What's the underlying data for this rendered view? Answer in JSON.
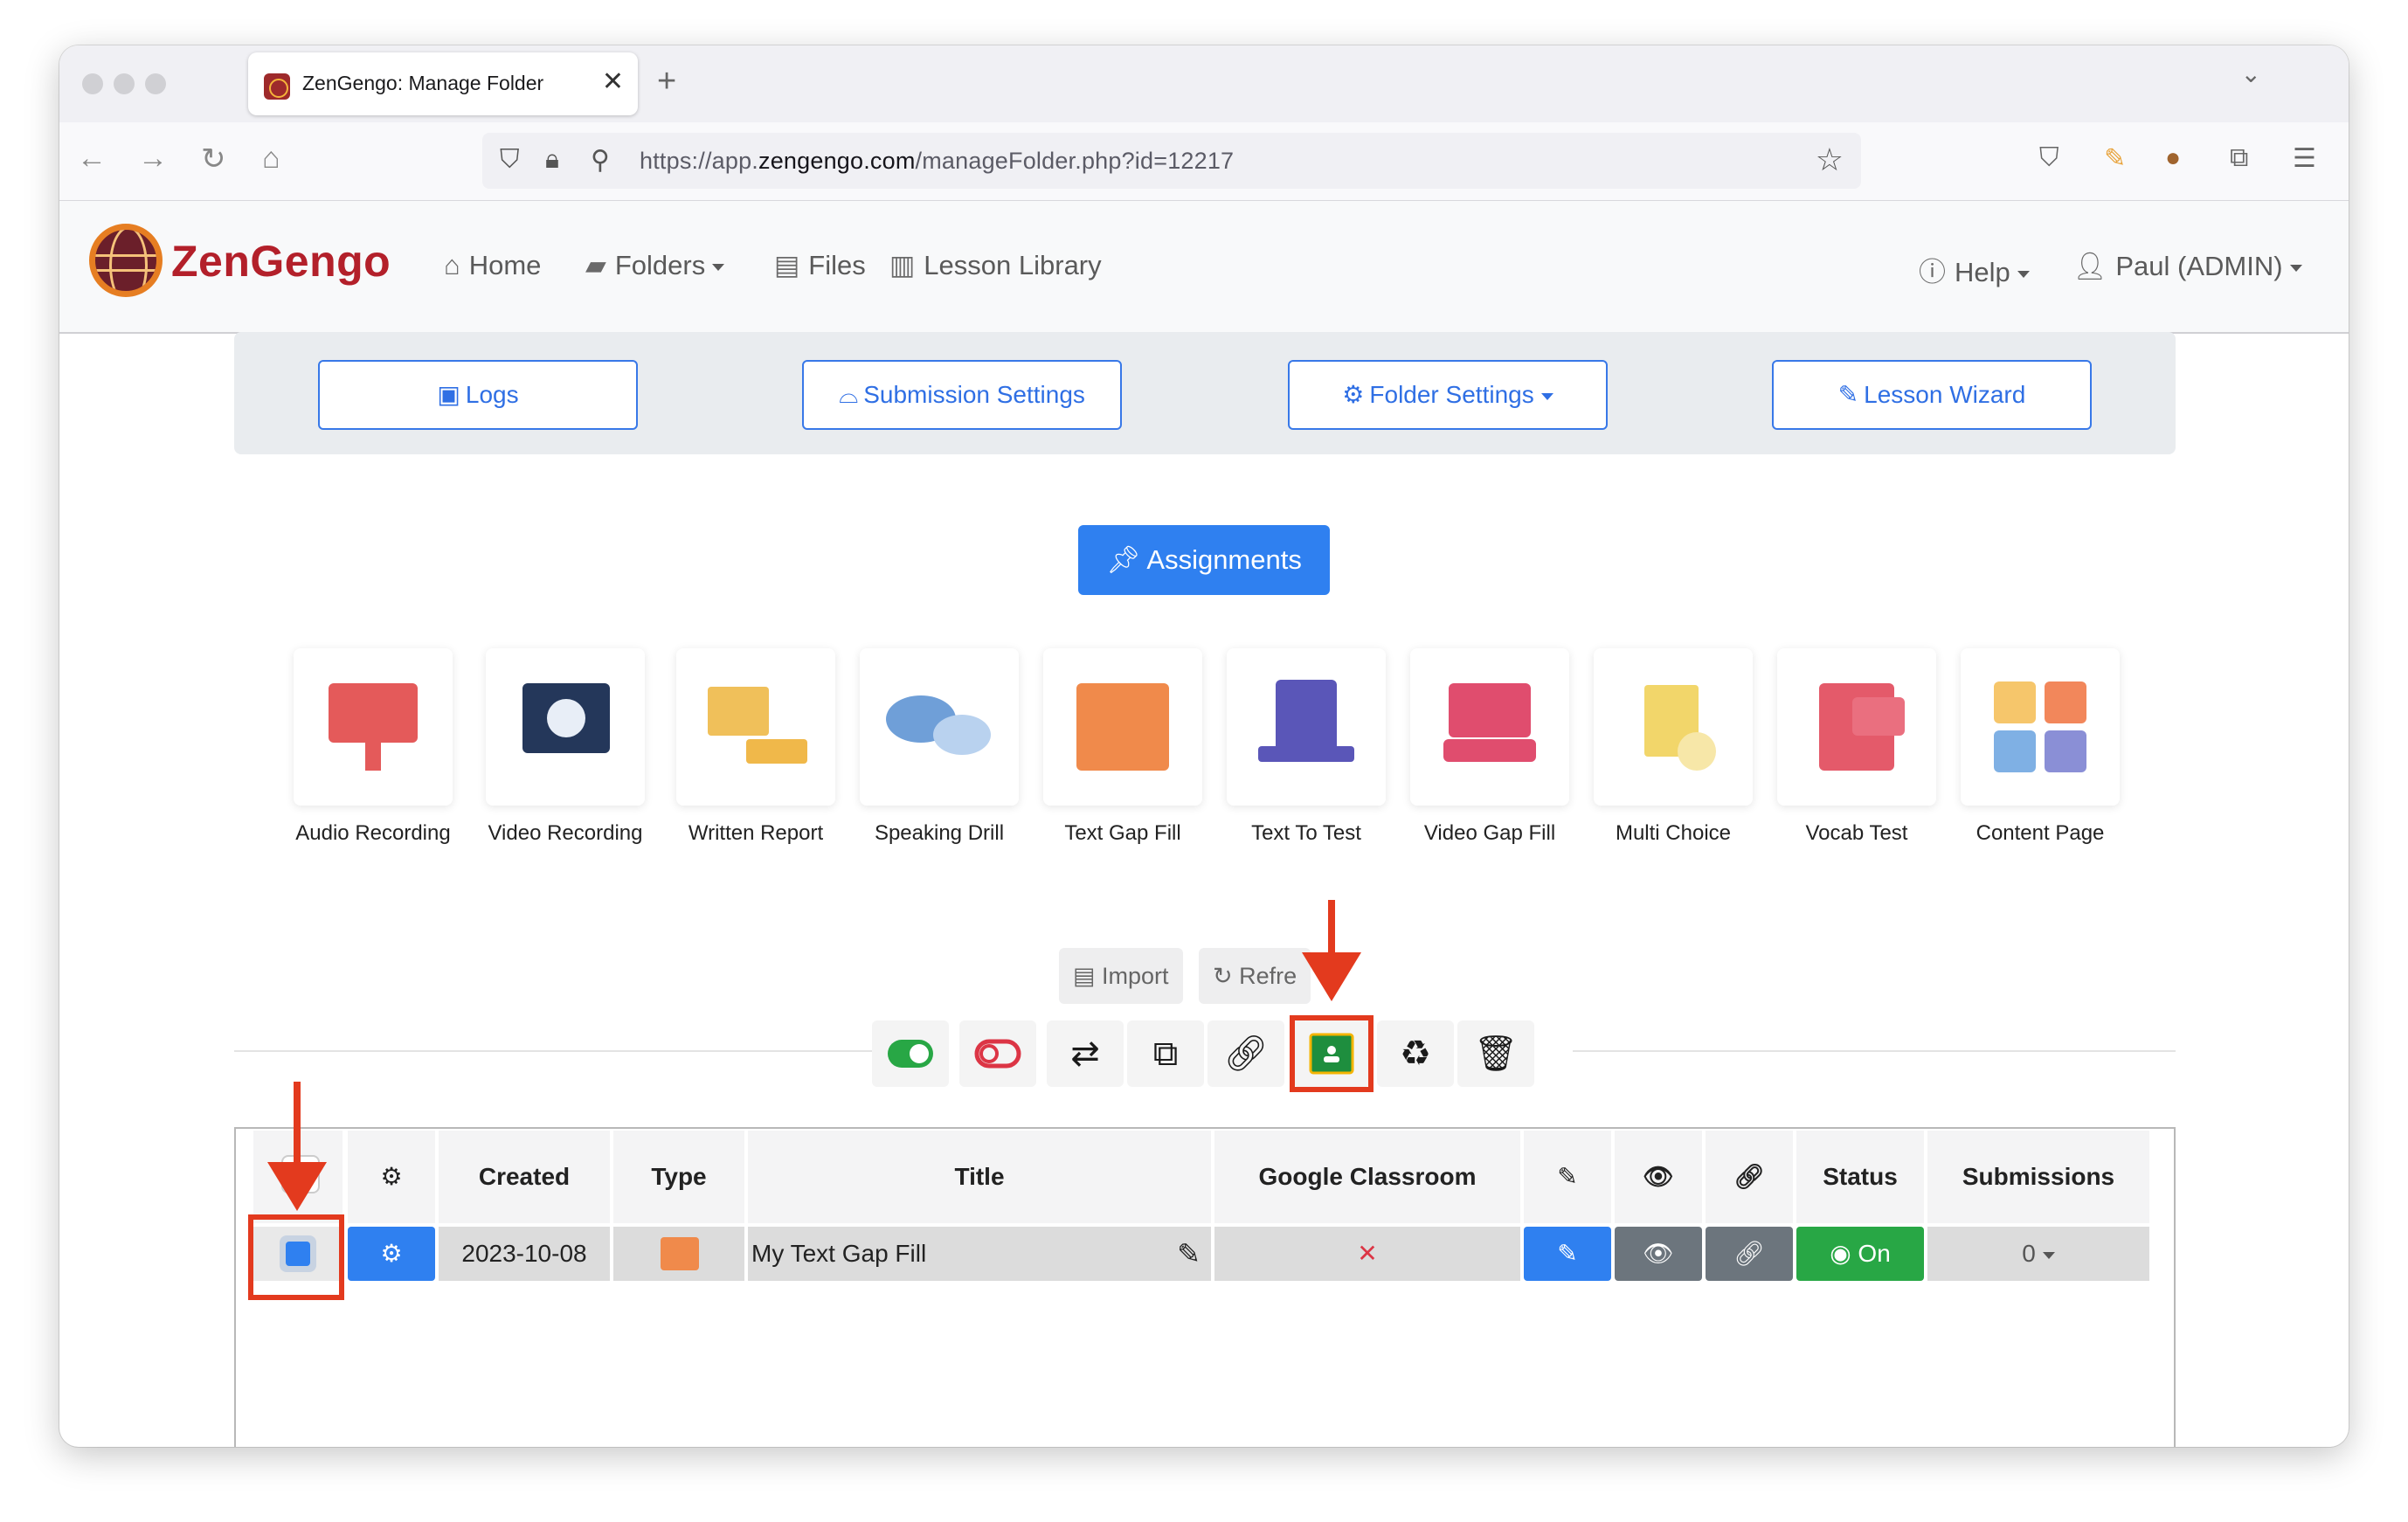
{
  "browser": {
    "tab_title": "ZenGengo: Manage Folder",
    "tab_close": "✕",
    "new_tab": "+",
    "url_prefix": "https://app.",
    "url_domain": "zengengo.com",
    "url_path": "/manageFolder.php?id=12217"
  },
  "navbar": {
    "logo_text": "ZenGengo",
    "items": [
      {
        "label": "Home",
        "icon": "home-icon"
      },
      {
        "label": "Folders",
        "icon": "folder-icon"
      },
      {
        "label": "Files",
        "icon": "file-icon"
      },
      {
        "label": "Lesson Library",
        "icon": "book-icon"
      }
    ],
    "help": "Help",
    "user": "Paul (ADMIN)"
  },
  "panel": {
    "logs": "Logs",
    "submission_settings": "Submission Settings",
    "folder_settings": "Folder Settings",
    "lesson_wizard": "Lesson Wizard"
  },
  "assignments_button": "Assignments",
  "assignment_types": [
    {
      "label": "Audio Recording",
      "icon": "audio-recording-icon"
    },
    {
      "label": "Video Recording",
      "icon": "video-recording-icon"
    },
    {
      "label": "Written Report",
      "icon": "written-report-icon"
    },
    {
      "label": "Speaking Drill",
      "icon": "speaking-drill-icon"
    },
    {
      "label": "Text Gap Fill",
      "icon": "text-gap-fill-icon"
    },
    {
      "label": "Text To Test",
      "icon": "text-to-test-icon"
    },
    {
      "label": "Video Gap Fill",
      "icon": "video-gap-fill-icon"
    },
    {
      "label": "Multi Choice",
      "icon": "multi-choice-icon"
    },
    {
      "label": "Vocab Test",
      "icon": "vocab-test-icon"
    },
    {
      "label": "Content Page",
      "icon": "content-page-icon"
    }
  ],
  "list_toolbar": {
    "import": "Import",
    "refresh": "Refre"
  },
  "table": {
    "headers": {
      "created": "Created",
      "type": "Type",
      "title": "Title",
      "google_classroom": "Google Classroom",
      "status": "Status",
      "submissions": "Submissions"
    },
    "rows": [
      {
        "created": "2023-10-08",
        "title": "My Text Gap Fill",
        "google_classroom": "✕",
        "status": "On",
        "submissions": "0"
      }
    ]
  },
  "colors": {
    "brand": "#b3202a",
    "primary": "#2f80f0",
    "success": "#28a745",
    "secondary": "#6c757d",
    "annotation": "#e33a1e"
  }
}
